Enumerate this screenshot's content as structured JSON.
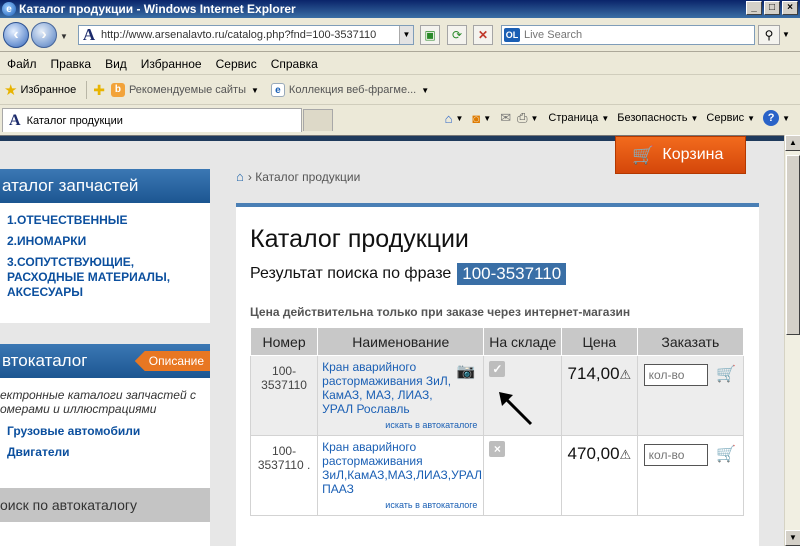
{
  "window": {
    "title": "Каталог продукции - Windows Internet Explorer",
    "buttons": [
      "_",
      "□",
      "×"
    ]
  },
  "address_bar": {
    "url": "http://www.arsenalavto.ru/catalog.php?fnd=100-3537110",
    "search_placeholder": "Live Search",
    "live_badge": "OL"
  },
  "menu": {
    "items": [
      "Файл",
      "Правка",
      "Вид",
      "Избранное",
      "Сервис",
      "Справка"
    ]
  },
  "favorites_bar": {
    "favorites_label": "Избранное",
    "item1": "Рекомендуемые сайты",
    "item2": "Коллекция веб-фрагме..."
  },
  "tab": {
    "title": "Каталог продукции"
  },
  "command_bar": {
    "page": "Страница",
    "security": "Безопасность",
    "tools": "Сервис",
    "help": "?"
  },
  "sidebar": {
    "catalog_header": "аталог запчастей",
    "catalog_links": [
      "1.ОТЕЧЕСТВЕННЫЕ",
      "2.ИНОМАРКИ",
      "3.СОПУТСТВУЮЩИЕ, РАСХОДНЫЕ МАТЕРИАЛЫ, АКСЕСУАРЫ"
    ],
    "autocatalog_header": "втокаталог",
    "description_badge": "Описание",
    "autocatalog_text": "ектронные каталоги запчастей с омерами и иллюстрациями",
    "autocatalog_links": [
      "Грузовые автомобили",
      "Двигатели"
    ],
    "search_header": "оиск по автокаталогу"
  },
  "cart": {
    "label": "Корзина"
  },
  "breadcrumb": {
    "current": "Каталог продукции"
  },
  "main": {
    "title": "Каталог продукции",
    "result_prefix": "Результат поиска по фразе",
    "query": "100-3537110",
    "notice": "Цена действительна только при заказе через интернет-магазин",
    "table": {
      "headers": [
        "Номер",
        "Наименование",
        "На складе",
        "Цена",
        "Заказать"
      ],
      "rows": [
        {
          "number": "100-3537110",
          "name": "Кран аварийного растормаживания ЗиЛ, КамАЗ, МАЗ, ЛИАЗ, УРАЛ Рославль",
          "catalog_link": "искать в автокаталоге",
          "stock": "✓",
          "price": "714,00",
          "qty_placeholder": "кол-во"
        },
        {
          "number": "100-3537110 .",
          "name": "Кран аварийного растормаживания ЗиЛ,КамАЗ,МАЗ,ЛИАЗ,УРАЛ ПААЗ",
          "catalog_link": "искать в автокаталоге",
          "stock": "×",
          "price": "470,00",
          "qty_placeholder": "кол-во"
        }
      ]
    }
  }
}
